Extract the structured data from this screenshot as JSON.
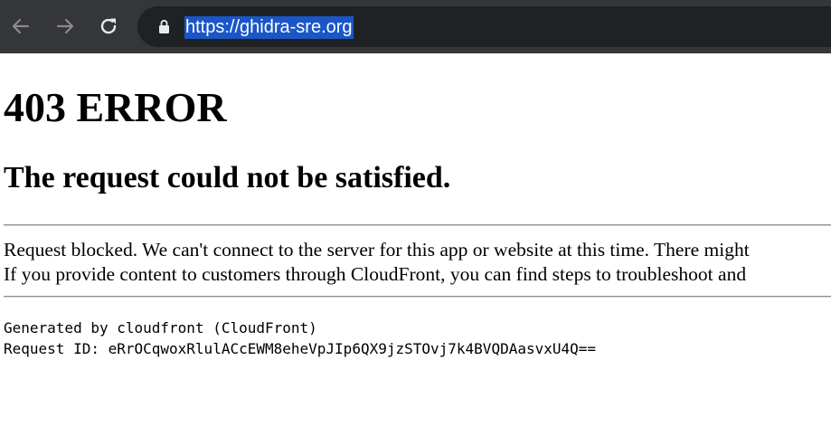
{
  "browser": {
    "url": "https://ghidra-sre.org",
    "buttons": {
      "back": "back-arrow-icon",
      "forward": "forward-arrow-icon",
      "reload": "reload-icon",
      "secure": "lock-icon"
    },
    "colors": {
      "toolbar": "#35363a",
      "omnibox": "#202124",
      "selection": "#1a56c7"
    }
  },
  "page": {
    "heading": "403 ERROR",
    "subheading": "The request could not be satisfied.",
    "message_line1": "Request blocked. We can't connect to the server for this app or website at this time. There might",
    "message_line2": "If you provide content to customers through CloudFront, you can find steps to troubleshoot and",
    "generated_by": "Generated by cloudfront (CloudFront)",
    "request_id": "Request ID: eRrOCqwoxRlulACcEWM8eheVpJIp6QX9jzSTOvj7k4BVQDAasvxU4Q=="
  }
}
